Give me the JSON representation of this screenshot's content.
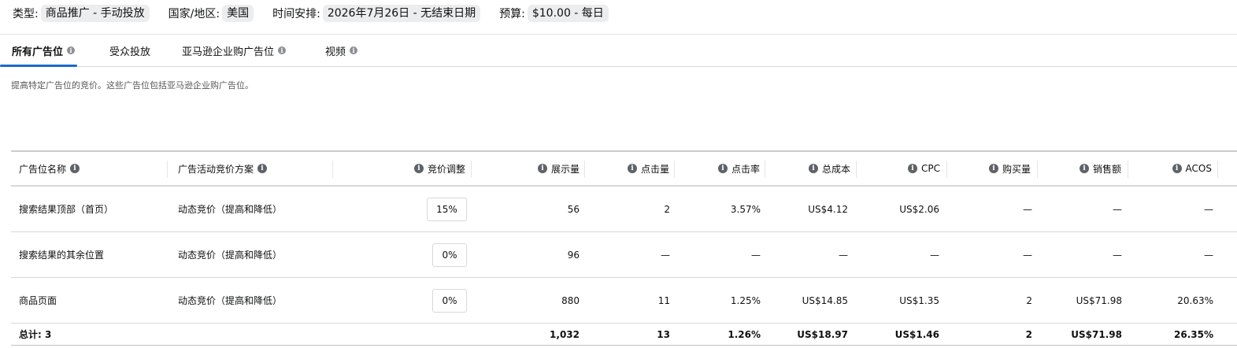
{
  "summary": {
    "type_label": "类型:",
    "type_value": "商品推广 - 手动投放",
    "country_label": "国家/地区:",
    "country_value": "美国",
    "schedule_label": "时间安排:",
    "schedule_value": "2026年7月26日 - 无结束日期",
    "budget_label": "预算:",
    "budget_value": "$10.00 - 每日"
  },
  "tabs": [
    {
      "label": "所有广告位",
      "active": true,
      "info": true
    },
    {
      "label": "受众投放",
      "active": false,
      "info": false
    },
    {
      "label": "亚马逊企业购广告位",
      "active": false,
      "info": true
    },
    {
      "label": "视频",
      "active": false,
      "info": true
    }
  ],
  "description": "提高特定广告位的竞价。这些广告位包括亚马逊企业购广告位。",
  "table": {
    "headers": {
      "placement": "广告位名称",
      "strategy": "广告活动竞价方案",
      "bid_adjust": "竞价调整",
      "impressions": "展示量",
      "clicks": "点击量",
      "ctr": "点击率",
      "spend": "总成本",
      "cpc": "CPC",
      "orders": "购买量",
      "sales": "销售额",
      "acos": "ACOS"
    },
    "rows": [
      {
        "placement": "搜索结果顶部（首页）",
        "strategy": "动态竞价（提高和降低）",
        "bid_adjust": "15%",
        "impressions": "56",
        "clicks": "2",
        "ctr": "3.57%",
        "spend": "US$4.12",
        "cpc": "US$2.06",
        "orders": "—",
        "sales": "—",
        "acos": "—"
      },
      {
        "placement": "搜索结果的其余位置",
        "strategy": "动态竞价（提高和降低）",
        "bid_adjust": "0%",
        "impressions": "96",
        "clicks": "—",
        "ctr": "—",
        "spend": "—",
        "cpc": "—",
        "orders": "—",
        "sales": "—",
        "acos": "—"
      },
      {
        "placement": "商品页面",
        "strategy": "动态竞价（提高和降低）",
        "bid_adjust": "0%",
        "impressions": "880",
        "clicks": "11",
        "ctr": "1.25%",
        "spend": "US$14.85",
        "cpc": "US$1.35",
        "orders": "2",
        "sales": "US$71.98",
        "acos": "20.63%"
      }
    ],
    "total": {
      "label": "总计: 3",
      "impressions": "1,032",
      "clicks": "13",
      "ctr": "1.26%",
      "spend": "US$18.97",
      "cpc": "US$1.46",
      "orders": "2",
      "sales": "US$71.98",
      "acos": "26.35%"
    }
  },
  "icons": {
    "info": "info-icon"
  },
  "colors": {
    "accent": "#1b6ac9",
    "chip_bg": "#ebedef",
    "border": "#d5d9d9"
  }
}
